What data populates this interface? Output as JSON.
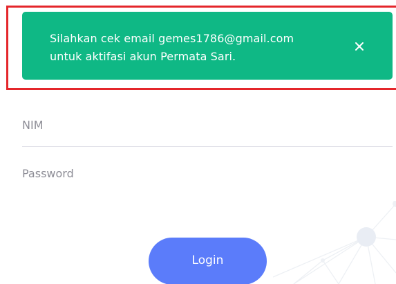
{
  "alert": {
    "message_line1": "Silahkan cek email gemes1786@gmail.com",
    "message_line2": "untuk aktifasi akun Permata Sari.",
    "background_color": "#0fb885",
    "close_icon": "close-icon"
  },
  "form": {
    "nim_placeholder": "NIM",
    "password_placeholder": "Password",
    "login_label": "Login",
    "login_color": "#5b7cfa"
  },
  "highlight_color": "#e4262b"
}
